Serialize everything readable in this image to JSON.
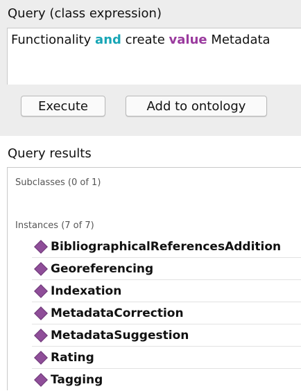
{
  "query": {
    "title": "Query (class expression)",
    "expression": {
      "t1": "Functionality",
      "kw1": "and",
      "t2": "create",
      "kw2": "value",
      "t3": "Metadata"
    },
    "execute_label": "Execute",
    "add_label": "Add to ontology"
  },
  "results": {
    "title": "Query results",
    "subclasses_label": "Subclasses (0 of 1)",
    "instances_label": "Instances (7 of 7)",
    "instances": [
      {
        "label": "BibliographicalReferencesAddition",
        "icon": "diamond-icon"
      },
      {
        "label": "Georeferencing",
        "icon": "diamond-icon"
      },
      {
        "label": "Indexation",
        "icon": "diamond-icon"
      },
      {
        "label": "MetadataCorrection",
        "icon": "diamond-icon"
      },
      {
        "label": "MetadataSuggestion",
        "icon": "diamond-icon"
      },
      {
        "label": "Rating",
        "icon": "diamond-icon"
      },
      {
        "label": "Tagging",
        "icon": "diamond-icon"
      }
    ]
  },
  "colors": {
    "keyword_and": "#18a6b6",
    "keyword_value": "#9a3a9e",
    "instance_icon": "#8f4e99"
  }
}
